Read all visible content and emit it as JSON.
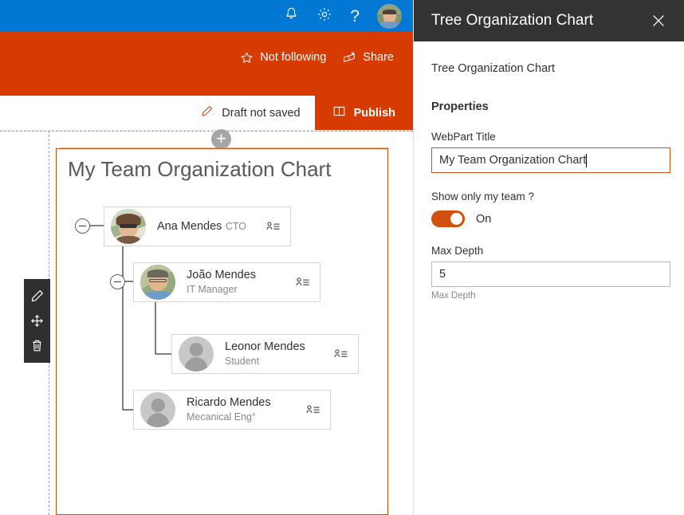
{
  "suite_bar": {
    "icons": [
      {
        "name": "notifications-bell-icon",
        "label": "Notifications"
      },
      {
        "name": "settings-gear-icon",
        "label": "Settings"
      },
      {
        "name": "help-question-icon",
        "label": "Help"
      },
      {
        "name": "user-avatar",
        "label": "Account manager"
      }
    ],
    "background": "#0078d4"
  },
  "site_header": {
    "background": "#d83b01",
    "follow_label": "Not following",
    "follow_icon": "star-outline-icon",
    "share_label": "Share",
    "share_icon": "share-arrow-icon"
  },
  "command_bar": {
    "draft_status": "Draft not saved",
    "draft_icon": "pencil-edit-icon",
    "publish_label": "Publish",
    "publish_icon": "book-publish-icon",
    "publish_color": "#d83b01"
  },
  "canvas": {
    "add_section_label": "+",
    "webpart_toolbar": [
      {
        "name": "edit-webpart-icon",
        "label": "Edit web part"
      },
      {
        "name": "move-webpart-icon",
        "label": "Move web part"
      },
      {
        "name": "delete-webpart-icon",
        "label": "Delete web part"
      }
    ]
  },
  "chart_data": {
    "type": "tree",
    "title": "My Team Organization Chart",
    "nodes": [
      {
        "id": "ana",
        "name": "Ana Mendes",
        "job_title": "CTO",
        "depth": 0,
        "avatar": "photo",
        "collapsible": true,
        "collapse_state": "expanded",
        "action_icon": "person-list-icon"
      },
      {
        "id": "joao",
        "name": "João Mendes",
        "job_title": "IT Manager",
        "depth": 1,
        "parent": "ana",
        "avatar": "photo",
        "collapsible": true,
        "collapse_state": "expanded",
        "action_icon": "person-list-icon"
      },
      {
        "id": "leonor",
        "name": "Leonor Mendes",
        "job_title": "Student",
        "depth": 2,
        "parent": "joao",
        "avatar": "placeholder",
        "collapsible": false,
        "action_icon": "person-list-icon"
      },
      {
        "id": "ricardo",
        "name": "Ricardo Mendes",
        "job_title": "Mecanical Eng°",
        "depth": 1,
        "parent": "ana",
        "avatar": "placeholder",
        "collapsible": false,
        "action_icon": "person-list-icon"
      }
    ]
  },
  "property_pane": {
    "header_title": "Tree Organization Chart",
    "close_icon": "close-x-icon",
    "webpart_name": "Tree Organization Chart",
    "properties_heading": "Properties",
    "fields": [
      {
        "name": "webpart-title",
        "label": "WebPart Title",
        "value": "My Team Organization Chart",
        "focused": true
      },
      {
        "name": "show-only-my-team",
        "label": "Show only my team ?",
        "toggle_state": "On",
        "toggle_color": "#d2500f"
      },
      {
        "name": "max-depth",
        "label": "Max Depth",
        "value": "5",
        "description": "Max Depth"
      }
    ]
  }
}
